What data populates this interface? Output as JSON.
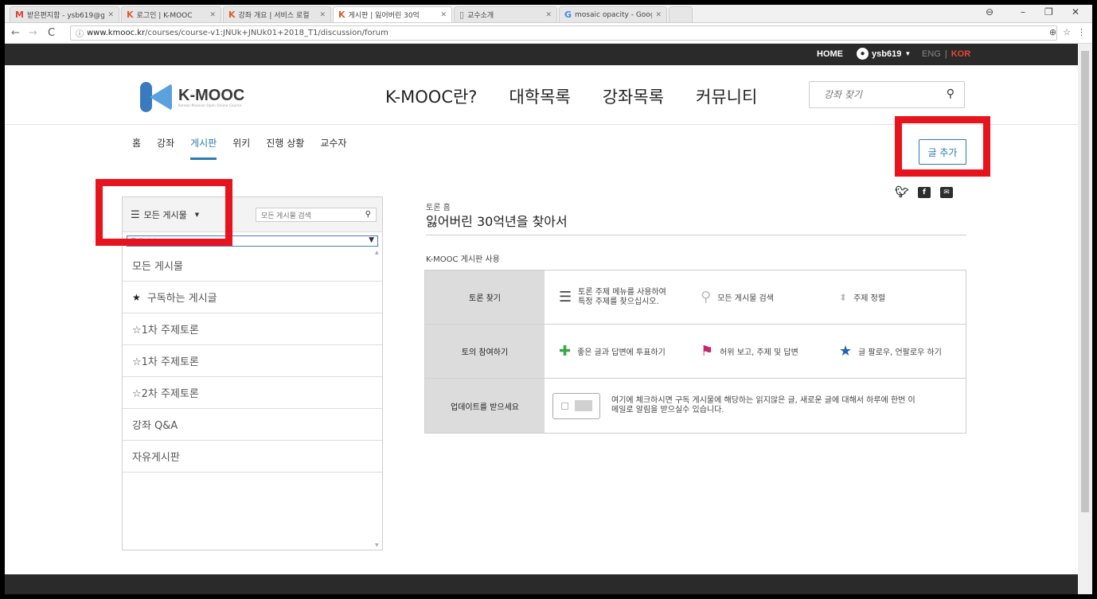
{
  "browser": {
    "tabs": [
      {
        "favicon": "M",
        "title": "받은편지함 - ysb619@g",
        "fav_color": "#d44638"
      },
      {
        "favicon": "K",
        "title": "로그인 | K-MOOC",
        "fav_color": "#e05a2b"
      },
      {
        "favicon": "K",
        "title": "강좌 개요 | 서비스 로컬",
        "fav_color": "#e05a2b"
      },
      {
        "favicon": "K",
        "title": "게시판 | 잃어버린 30억",
        "fav_color": "#e05a2b"
      },
      {
        "favicon": "▯",
        "title": "교수소개",
        "fav_color": "#777777"
      },
      {
        "favicon": "G",
        "title": "mosaic opacity - Googl",
        "fav_color": "#4285f4"
      }
    ],
    "url_host": "www.kmooc.kr",
    "url_path": "/courses/course-v1:JNUk+JNUk01+2018_T1/discussion/forum"
  },
  "topbar": {
    "home": "HOME",
    "username": "ysb619",
    "lang_eng": "ENG",
    "lang_sep": "|",
    "lang_kor": "KOR"
  },
  "header": {
    "logo_text": "K-MOOC",
    "logo_sub": "Korean Massive Open Online Course",
    "nav": [
      "K-MOOC란?",
      "대학목록",
      "강좌목록",
      "커뮤니티"
    ],
    "search_placeholder": "강좌 찾기"
  },
  "subnav": [
    "홈",
    "강좌",
    "게시판",
    "위키",
    "진행 상황",
    "교수자"
  ],
  "add_post": "글 추가",
  "sidebar": {
    "menu_label": "모든 게시물",
    "search_placeholder": "모든 게시물 검색",
    "filter_placeholder": "주제 필터",
    "items": [
      {
        "label": "모든 게시물",
        "star": ""
      },
      {
        "label": "구독하는 게시글",
        "star": "★"
      },
      {
        "label": "☆1차 주제토론",
        "star": ""
      },
      {
        "label": "☆1차 주제토론",
        "star": ""
      },
      {
        "label": "☆2차 주제토론",
        "star": ""
      },
      {
        "label": "강좌 Q&A",
        "star": ""
      },
      {
        "label": "자유게시판",
        "star": ""
      }
    ]
  },
  "content": {
    "breadcrumb": "토론 홈",
    "title": "잃어버린 30억년을 찾아서",
    "howto_title": "K-MOOC 게시판 사용",
    "rows": [
      {
        "label": "토론 찾기",
        "cells": [
          {
            "icon": "menu-icon",
            "text1": "토론 주제 메뉴를 사용하여",
            "text2": "특정 주제를 찾으십시오."
          },
          {
            "icon": "search-icon",
            "text1": "모든 게시물 검색",
            "text2": ""
          },
          {
            "icon": "sort-icon",
            "text1": "주제 정렬",
            "text2": ""
          }
        ]
      },
      {
        "label": "토의 참여하기",
        "cells": [
          {
            "icon": "plus-icon",
            "text1": "좋은 글과 답변에 투표하기",
            "text2": ""
          },
          {
            "icon": "flag-icon",
            "text1": "허위 보고, 주제 및 답변",
            "text2": ""
          },
          {
            "icon": "star-icon",
            "text1": "글 팔로우, 언팔로우 하기",
            "text2": ""
          }
        ]
      },
      {
        "label": "업데이트를 받으세요",
        "text1": "여기에 체크하시면 구독 게시물에 해당하는 읽지않은 글, 새로운 글에 대해서 하루에 한번 이",
        "text2": "메일로 알림을 받으실수 있습니다."
      }
    ]
  },
  "colors": {
    "accent": "#2b7ab2",
    "highlight": "#e8141d",
    "plus": "#3aa845",
    "flag": "#c2286b",
    "star": "#1e63b5"
  }
}
